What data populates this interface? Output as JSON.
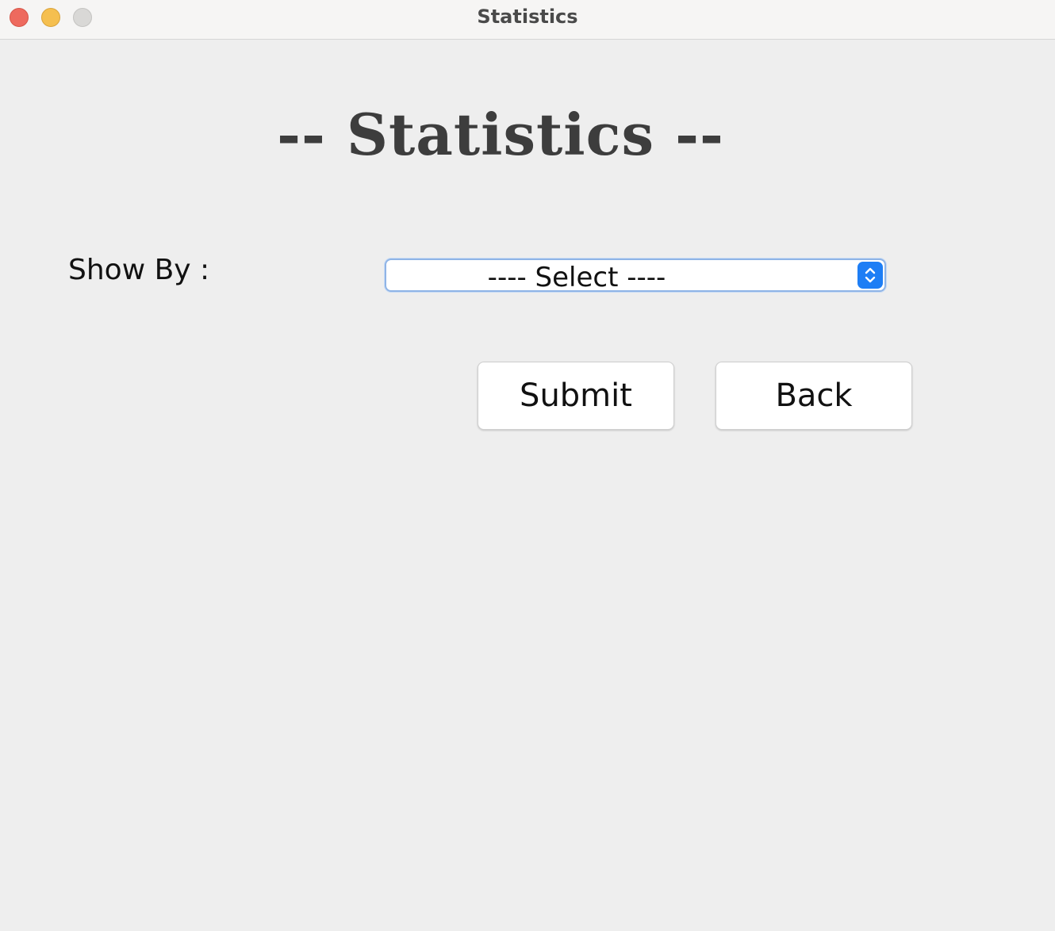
{
  "window": {
    "title": "Statistics"
  },
  "main": {
    "heading": "-- Statistics --",
    "show_by_label": "Show By :",
    "show_by_select": {
      "selected": "---- Select ----"
    },
    "submit_label": "Submit",
    "back_label": "Back"
  },
  "colors": {
    "background": "#eeeeee",
    "titlebar": "#f6f5f4",
    "heading": "#3d3d3d",
    "select_focus_border": "#8fb4e6",
    "stepper_accent": "#1e7ef5",
    "close_light": "#ee6a5e",
    "minimize_light": "#f5bf4f",
    "zoom_light": "#d9d8d6"
  },
  "icons": {
    "stepper": "chevron-up-down-icon"
  }
}
